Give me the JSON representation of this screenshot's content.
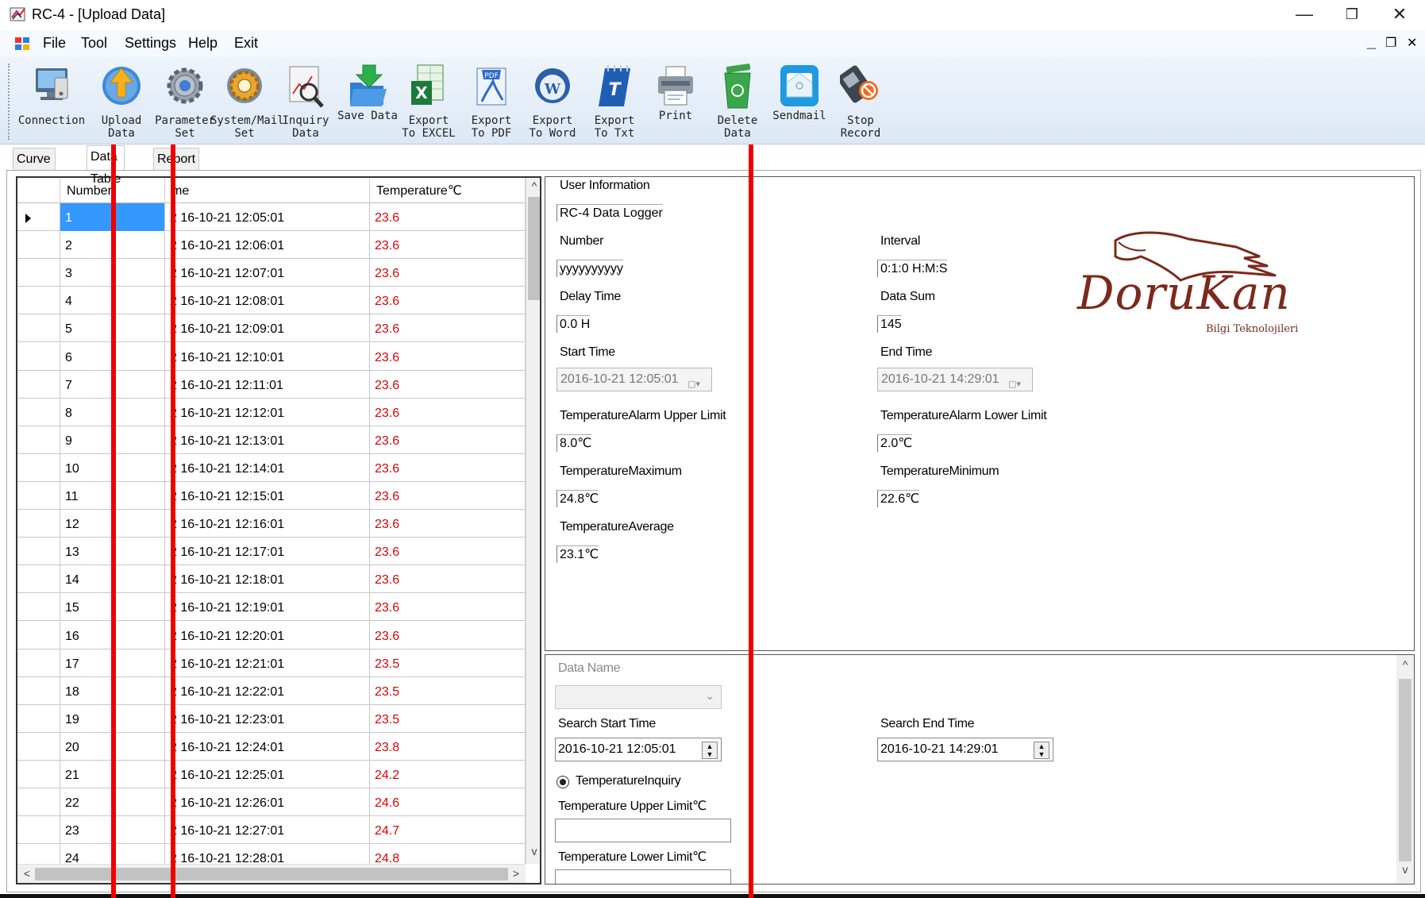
{
  "window": {
    "title": "RC-4 - [Upload Data]",
    "controls": [
      "—",
      "❐",
      "✕"
    ]
  },
  "menu": {
    "items": [
      "File",
      "Tool",
      "Settings",
      "Help",
      "Exit"
    ],
    "mdi_controls": [
      "_",
      "❐",
      "✕"
    ]
  },
  "toolbar": {
    "buttons": [
      {
        "label": "Connection"
      },
      {
        "label": "Upload\nData"
      },
      {
        "label": "Parameter\nSet"
      },
      {
        "label": "System/Mail\nSet"
      },
      {
        "label": "Inquiry\nData"
      },
      {
        "label": "Save Data"
      },
      {
        "label": "Export\nTo EXCEL"
      },
      {
        "label": "Export\nTo PDF"
      },
      {
        "label": "Export\nTo Word"
      },
      {
        "label": "Export\nTo Txt"
      },
      {
        "label": "Print"
      },
      {
        "label": "Delete\nData"
      },
      {
        "label": "Sendmail"
      },
      {
        "label": "Stop\nRecord"
      }
    ]
  },
  "tabs": [
    "Curve Graph",
    "Data Table",
    "Report"
  ],
  "table": {
    "headers": [
      "Number",
      "Time",
      "Temperature℃"
    ],
    "header_display": [
      "Number",
      "me",
      "Temperature℃"
    ],
    "rows": [
      {
        "n": "1",
        "time": "2016-10-21 12:05:01",
        "time_display": "2 16-10-21 12:05:01",
        "temp": "23.6"
      },
      {
        "n": "2",
        "time": "2016-10-21 12:06:01",
        "time_display": "2 16-10-21 12:06:01",
        "temp": "23.6"
      },
      {
        "n": "3",
        "time": "2016-10-21 12:07:01",
        "time_display": "2 16-10-21 12:07:01",
        "temp": "23.6"
      },
      {
        "n": "4",
        "time": "2016-10-21 12:08:01",
        "time_display": "2 16-10-21 12:08:01",
        "temp": "23.6"
      },
      {
        "n": "5",
        "time": "2016-10-21 12:09:01",
        "time_display": "2 16-10-21 12:09:01",
        "temp": "23.6"
      },
      {
        "n": "6",
        "time": "2016-10-21 12:10:01",
        "time_display": "2 16-10-21 12:10:01",
        "temp": "23.6"
      },
      {
        "n": "7",
        "time": "2016-10-21 12:11:01",
        "time_display": "2 16-10-21 12:11:01",
        "temp": "23.6"
      },
      {
        "n": "8",
        "time": "2016-10-21 12:12:01",
        "time_display": "2 16-10-21 12:12:01",
        "temp": "23.6"
      },
      {
        "n": "9",
        "time": "2016-10-21 12:13:01",
        "time_display": "2 16-10-21 12:13:01",
        "temp": "23.6"
      },
      {
        "n": "10",
        "time": "2016-10-21 12:14:01",
        "time_display": "2 16-10-21 12:14:01",
        "temp": "23.6"
      },
      {
        "n": "11",
        "time": "2016-10-21 12:15:01",
        "time_display": "2 16-10-21 12:15:01",
        "temp": "23.6"
      },
      {
        "n": "12",
        "time": "2016-10-21 12:16:01",
        "time_display": "2 16-10-21 12:16:01",
        "temp": "23.6"
      },
      {
        "n": "13",
        "time": "2016-10-21 12:17:01",
        "time_display": "2 16-10-21 12:17:01",
        "temp": "23.6"
      },
      {
        "n": "14",
        "time": "2016-10-21 12:18:01",
        "time_display": "2 16-10-21 12:18:01",
        "temp": "23.6"
      },
      {
        "n": "15",
        "time": "2016-10-21 12:19:01",
        "time_display": "2 16-10-21 12:19:01",
        "temp": "23.6"
      },
      {
        "n": "16",
        "time": "2016-10-21 12:20:01",
        "time_display": "2 16-10-21 12:20:01",
        "temp": "23.6"
      },
      {
        "n": "17",
        "time": "2016-10-21 12:21:01",
        "time_display": "2 16-10-21 12:21:01",
        "temp": "23.5"
      },
      {
        "n": "18",
        "time": "2016-10-21 12:22:01",
        "time_display": "2 16-10-21 12:22:01",
        "temp": "23.5"
      },
      {
        "n": "19",
        "time": "2016-10-21 12:23:01",
        "time_display": "2 16-10-21 12:23:01",
        "temp": "23.5"
      },
      {
        "n": "20",
        "time": "2016-10-21 12:24:01",
        "time_display": "2 16-10-21 12:24:01",
        "temp": "23.8"
      },
      {
        "n": "21",
        "time": "2016-10-21 12:25:01",
        "time_display": "2 16-10-21 12:25:01",
        "temp": "24.2"
      },
      {
        "n": "22",
        "time": "2016-10-21 12:26:01",
        "time_display": "2 16-10-21 12:26:01",
        "temp": "24.6"
      },
      {
        "n": "23",
        "time": "2016-10-21 12:27:01",
        "time_display": "2 16-10-21 12:27:01",
        "temp": "24.7"
      },
      {
        "n": "24",
        "time": "2016-10-21 12:28:01",
        "time_display": "2 16-10-21 12:28:01",
        "temp": "24.8"
      }
    ],
    "selected_row": 1,
    "scroll_glyphs": {
      "up": "^",
      "down": "v",
      "left": "<",
      "right": ">"
    }
  },
  "info": {
    "user_information_label": "User Information",
    "user_information_value": "RC-4 Data Logger",
    "number_label": "Number",
    "number_value": "yyyyyyyyyy",
    "interval_label": "Interval",
    "interval_value": "0:1:0 H:M:S",
    "delay_time_label": "Delay Time",
    "delay_time_value": "0.0 H",
    "data_sum_label": "Data Sum",
    "data_sum_value": "145",
    "start_time_label": "Start Time",
    "start_time_value": "2016-10-21 12:05:01",
    "end_time_label": "End Time",
    "end_time_value": "2016-10-21 14:29:01",
    "upper_limit_label": "TemperatureAlarm Upper Limit",
    "upper_limit_value": "8.0℃",
    "lower_limit_label": "TemperatureAlarm Lower Limit",
    "lower_limit_value": "2.0℃",
    "maximum_label": "TemperatureMaximum",
    "maximum_value": "24.8℃",
    "minimum_label": "TemperatureMinimum",
    "minimum_value": "22.6℃",
    "average_label": "TemperatureAverage",
    "average_value": "23.1℃",
    "logo_text": "DoruKan",
    "logo_subtitle": "Bilgi Teknolojileri"
  },
  "search": {
    "data_name_label": "Data Name",
    "data_name_value": "",
    "start_label": "Search Start Time",
    "start_value": "2016-10-21 12:05:01",
    "end_label": "Search End Time",
    "end_value": "2016-10-21 14:29:01",
    "radio_label": "TemperatureInquiry",
    "upper_label": "Temperature Upper Limit℃",
    "upper_value": "",
    "lower_label": "Temperature Lower Limit℃",
    "lower_value": ""
  },
  "colors": {
    "temperature_text": "#e00000",
    "selection": "#3399ff",
    "annotation_line": "#ee0000"
  }
}
